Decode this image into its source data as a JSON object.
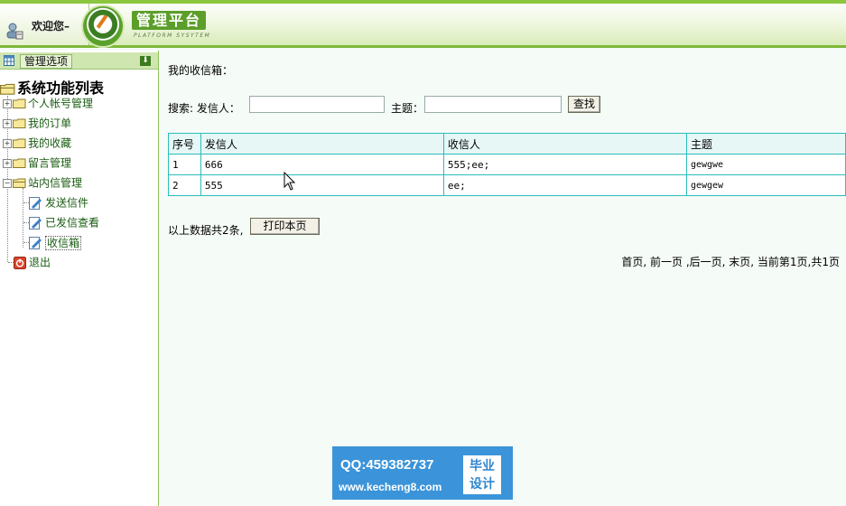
{
  "header": {
    "welcome": "欢迎您–",
    "platform_title": "管理平台",
    "platform_subtitle": "PLATFORM SYSYTEM"
  },
  "sidebar": {
    "options_label": "管理选项",
    "tree_title": "系统功能列表",
    "items": [
      {
        "label": "个人帐号管理",
        "icon": "folder-icon"
      },
      {
        "label": "我的订单",
        "icon": "folder-icon"
      },
      {
        "label": "我的收藏",
        "icon": "folder-icon"
      },
      {
        "label": "留言管理",
        "icon": "folder-icon"
      },
      {
        "label": "站内信管理",
        "icon": "folder-open-icon"
      },
      {
        "label": "发送信件",
        "icon": "document-icon"
      },
      {
        "label": "已发信查看",
        "icon": "document-icon"
      },
      {
        "label": "收信箱",
        "icon": "document-icon"
      },
      {
        "label": "退出",
        "icon": "exit-icon"
      }
    ]
  },
  "main": {
    "inbox_title": "我的收信箱：",
    "search_label": "搜索: 发信人：",
    "sender_value": "",
    "subject_label": "主题：",
    "subject_value": "",
    "search_button": "查找",
    "table": {
      "headers": [
        "序号",
        "发信人",
        "收信人",
        "主题"
      ],
      "rows": [
        [
          "1",
          "666",
          "555;ee;",
          "gewgwe"
        ],
        [
          "2",
          "555",
          "ee;",
          "gewgew"
        ]
      ]
    },
    "total_text": "以上数据共2条,",
    "print_button": "打印本页",
    "pager": "首页, 前一页 ,后一页, 末页, 当前第1页,共1页"
  },
  "watermark": {
    "qq": "QQ:459382737",
    "url": "www.kecheng8.com",
    "badge_line1": "毕业",
    "badge_line2": "设计"
  },
  "colors": {
    "accent_green": "#7fb83a",
    "table_border": "#2bbdbd",
    "watermark_blue": "#3b94d9"
  }
}
